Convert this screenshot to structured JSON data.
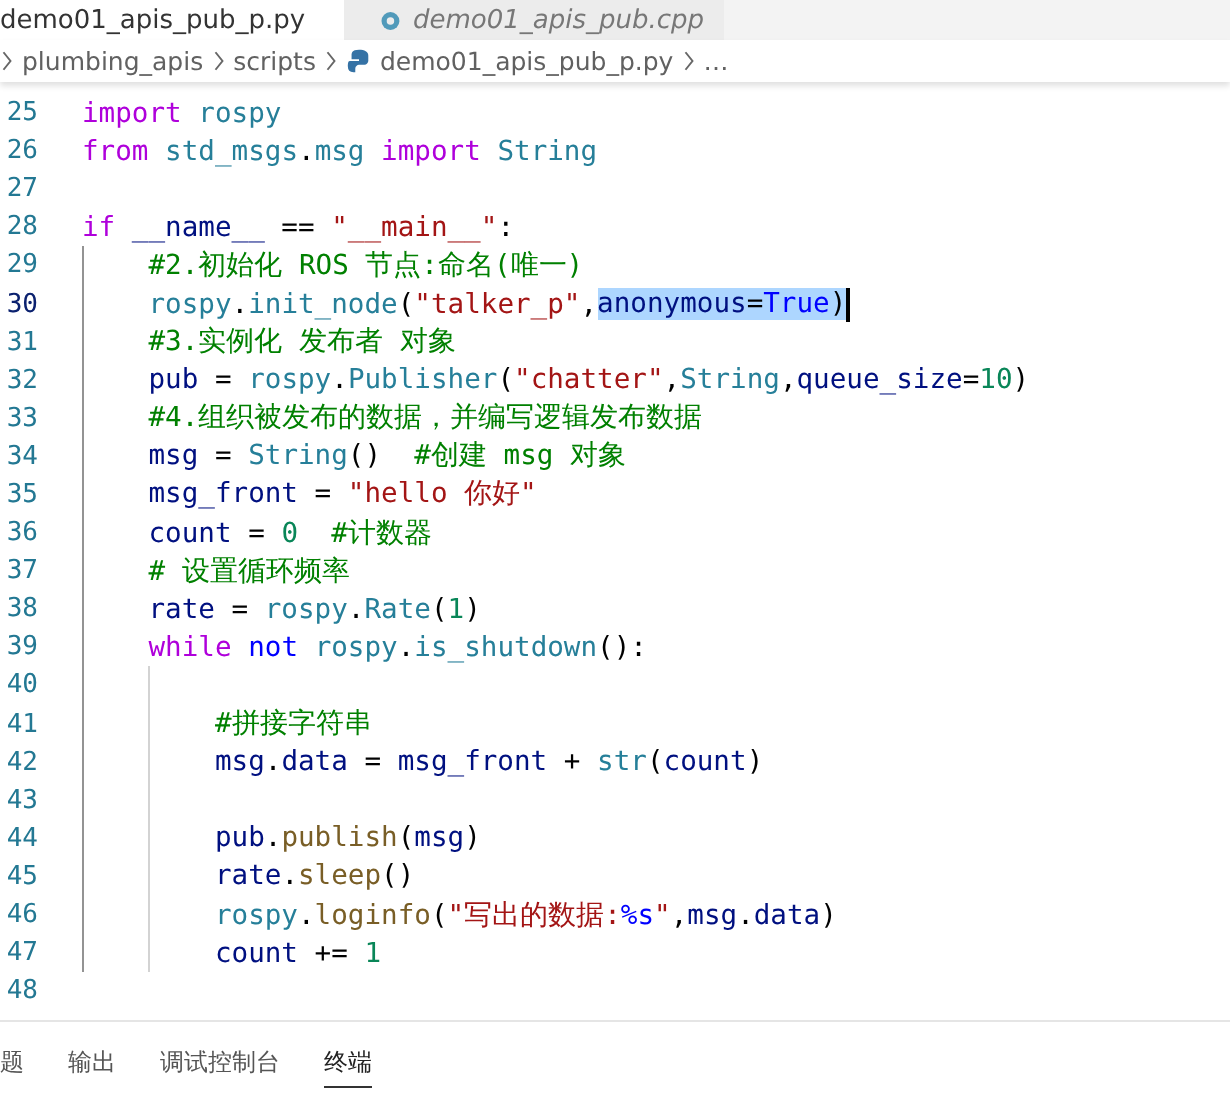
{
  "tabs": [
    {
      "label": "demo01_apis_pub_p.py",
      "selected": true
    },
    {
      "label": "demo01_apis_pub.cpp",
      "selected": false
    }
  ],
  "breadcrumbs": [
    "plumbing_apis",
    "scripts",
    "demo01_apis_pub_p.py",
    "…"
  ],
  "editor": {
    "lines": [
      {
        "number": "25",
        "current": false,
        "tokens": [
          {
            "text": "import ",
            "kind": "kw"
          },
          {
            "text": "rospy",
            "kind": "mod"
          }
        ]
      },
      {
        "number": "26",
        "current": false,
        "tokens": [
          {
            "text": "from ",
            "kind": "kw"
          },
          {
            "text": "std_msgs",
            "kind": "mod"
          },
          {
            "text": ".",
            "kind": "op"
          },
          {
            "text": "msg ",
            "kind": "mod"
          },
          {
            "text": "import ",
            "kind": "kw"
          },
          {
            "text": "String",
            "kind": "mod"
          }
        ]
      },
      {
        "number": "27",
        "current": false
      },
      {
        "number": "28",
        "current": false,
        "tokens": [
          {
            "text": "if ",
            "kind": "kw"
          },
          {
            "text": "__name__",
            "kind": "var"
          },
          {
            "text": " == ",
            "kind": "op"
          },
          {
            "text": "\"__main__\"",
            "kind": "str"
          },
          {
            "text": ":",
            "kind": "op"
          }
        ]
      },
      {
        "number": "29",
        "current": false,
        "tokens": [
          {
            "text": "    #2.初始化 ROS 节点:命名(唯一)",
            "kind": "cm"
          }
        ]
      },
      {
        "number": "30",
        "current": true,
        "tokens": [
          {
            "text": "    rospy",
            "kind": "mod",
            "selected": false
          },
          {
            "text": ".",
            "kind": "op",
            "selected": false
          },
          {
            "text": "init_node",
            "kind": "mod",
            "selected": false
          },
          {
            "text": "(",
            "kind": "op",
            "selected": false
          },
          {
            "text": "\"talker_p\"",
            "kind": "str",
            "selected": false
          },
          {
            "text": ",",
            "kind": "op",
            "selected": false
          },
          {
            "text": "anonymous",
            "kind": "var",
            "selected": true
          },
          {
            "text": "=",
            "kind": "op",
            "selected": true
          },
          {
            "text": "True",
            "kind": "const",
            "selected": true
          },
          {
            "text": ")",
            "kind": "op",
            "selected": true
          }
        ]
      },
      {
        "number": "31",
        "current": false,
        "tokens": [
          {
            "text": "    #3.实例化 发布者 对象",
            "kind": "cm"
          }
        ]
      },
      {
        "number": "32",
        "current": false,
        "tokens": [
          {
            "text": "    pub",
            "kind": "var"
          },
          {
            "text": " = ",
            "kind": "op"
          },
          {
            "text": "rospy",
            "kind": "mod"
          },
          {
            "text": ".",
            "kind": "op"
          },
          {
            "text": "Publisher",
            "kind": "mod"
          },
          {
            "text": "(",
            "kind": "op"
          },
          {
            "text": "\"chatter\"",
            "kind": "str"
          },
          {
            "text": ",",
            "kind": "op"
          },
          {
            "text": "String",
            "kind": "mod"
          },
          {
            "text": ",",
            "kind": "op"
          },
          {
            "text": "queue_size",
            "kind": "var"
          },
          {
            "text": "=",
            "kind": "op"
          },
          {
            "text": "10",
            "kind": "num"
          },
          {
            "text": ")",
            "kind": "op"
          }
        ]
      },
      {
        "number": "33",
        "current": false,
        "tokens": [
          {
            "text": "    #4.组织被发布的数据，并编写逻辑发布数据",
            "kind": "cm"
          }
        ]
      },
      {
        "number": "34",
        "current": false,
        "tokens": [
          {
            "text": "    msg",
            "kind": "var"
          },
          {
            "text": " = ",
            "kind": "op"
          },
          {
            "text": "String",
            "kind": "mod"
          },
          {
            "text": "()",
            "kind": "op"
          },
          {
            "text": "  #创建 msg 对象",
            "kind": "cm"
          }
        ]
      },
      {
        "number": "35",
        "current": false,
        "tokens": [
          {
            "text": "    msg_front",
            "kind": "var"
          },
          {
            "text": " = ",
            "kind": "op"
          },
          {
            "text": "\"hello 你好\"",
            "kind": "str"
          }
        ]
      },
      {
        "number": "36",
        "current": false,
        "tokens": [
          {
            "text": "    count",
            "kind": "var"
          },
          {
            "text": " = ",
            "kind": "op"
          },
          {
            "text": "0",
            "kind": "num"
          },
          {
            "text": "  #计数器",
            "kind": "cm"
          }
        ]
      },
      {
        "number": "37",
        "current": false,
        "tokens": [
          {
            "text": "    # 设置循环频率",
            "kind": "cm"
          }
        ]
      },
      {
        "number": "38",
        "current": false,
        "tokens": [
          {
            "text": "    rate",
            "kind": "var"
          },
          {
            "text": " = ",
            "kind": "op"
          },
          {
            "text": "rospy",
            "kind": "mod"
          },
          {
            "text": ".",
            "kind": "op"
          },
          {
            "text": "Rate",
            "kind": "mod"
          },
          {
            "text": "(",
            "kind": "op"
          },
          {
            "text": "1",
            "kind": "num"
          },
          {
            "text": ")",
            "kind": "op"
          }
        ]
      },
      {
        "number": "39",
        "current": false,
        "tokens": [
          {
            "text": "    while ",
            "kind": "kw"
          },
          {
            "text": "not ",
            "kind": "const"
          },
          {
            "text": "rospy",
            "kind": "mod"
          },
          {
            "text": ".",
            "kind": "op"
          },
          {
            "text": "is_shutdown",
            "kind": "mod"
          },
          {
            "text": "():",
            "kind": "op"
          }
        ]
      },
      {
        "number": "40",
        "current": false
      },
      {
        "number": "41",
        "current": false,
        "tokens": [
          {
            "text": "        #拼接字符串",
            "kind": "cm"
          }
        ]
      },
      {
        "number": "42",
        "current": false,
        "tokens": [
          {
            "text": "        msg",
            "kind": "var"
          },
          {
            "text": ".",
            "kind": "op"
          },
          {
            "text": "data",
            "kind": "var"
          },
          {
            "text": " = ",
            "kind": "op"
          },
          {
            "text": "msg_front",
            "kind": "var"
          },
          {
            "text": " + ",
            "kind": "op"
          },
          {
            "text": "str",
            "kind": "mod"
          },
          {
            "text": "(",
            "kind": "op"
          },
          {
            "text": "count",
            "kind": "var"
          },
          {
            "text": ")",
            "kind": "op"
          }
        ]
      },
      {
        "number": "43",
        "current": false
      },
      {
        "number": "44",
        "current": false,
        "tokens": [
          {
            "text": "        pub",
            "kind": "var"
          },
          {
            "text": ".",
            "kind": "op"
          },
          {
            "text": "publish",
            "kind": "fn"
          },
          {
            "text": "(",
            "kind": "op"
          },
          {
            "text": "msg",
            "kind": "var"
          },
          {
            "text": ")",
            "kind": "op"
          }
        ]
      },
      {
        "number": "45",
        "current": false,
        "tokens": [
          {
            "text": "        rate",
            "kind": "var"
          },
          {
            "text": ".",
            "kind": "op"
          },
          {
            "text": "sleep",
            "kind": "fn"
          },
          {
            "text": "()",
            "kind": "op"
          }
        ]
      },
      {
        "number": "46",
        "current": false,
        "tokens": [
          {
            "text": "        rospy",
            "kind": "mod"
          },
          {
            "text": ".",
            "kind": "op"
          },
          {
            "text": "loginfo",
            "kind": "fn"
          },
          {
            "text": "(",
            "kind": "op"
          },
          {
            "text": "\"写出的数据:",
            "kind": "str"
          },
          {
            "text": "%s",
            "kind": "const"
          },
          {
            "text": "\"",
            "kind": "str"
          },
          {
            "text": ",",
            "kind": "op"
          },
          {
            "text": "msg",
            "kind": "var"
          },
          {
            "text": ".",
            "kind": "op"
          },
          {
            "text": "data",
            "kind": "var"
          },
          {
            "text": ")",
            "kind": "op"
          }
        ]
      },
      {
        "number": "47",
        "current": false,
        "tokens": [
          {
            "text": "        count",
            "kind": "var"
          },
          {
            "text": " += ",
            "kind": "op"
          },
          {
            "text": "1",
            "kind": "num"
          }
        ]
      },
      {
        "number": "48",
        "current": false
      }
    ]
  },
  "panel_tabs": [
    {
      "label": "题",
      "selected": false
    },
    {
      "label": "输出",
      "selected": false
    },
    {
      "label": "调试控制台",
      "selected": false
    },
    {
      "label": "终端",
      "selected": true
    }
  ]
}
